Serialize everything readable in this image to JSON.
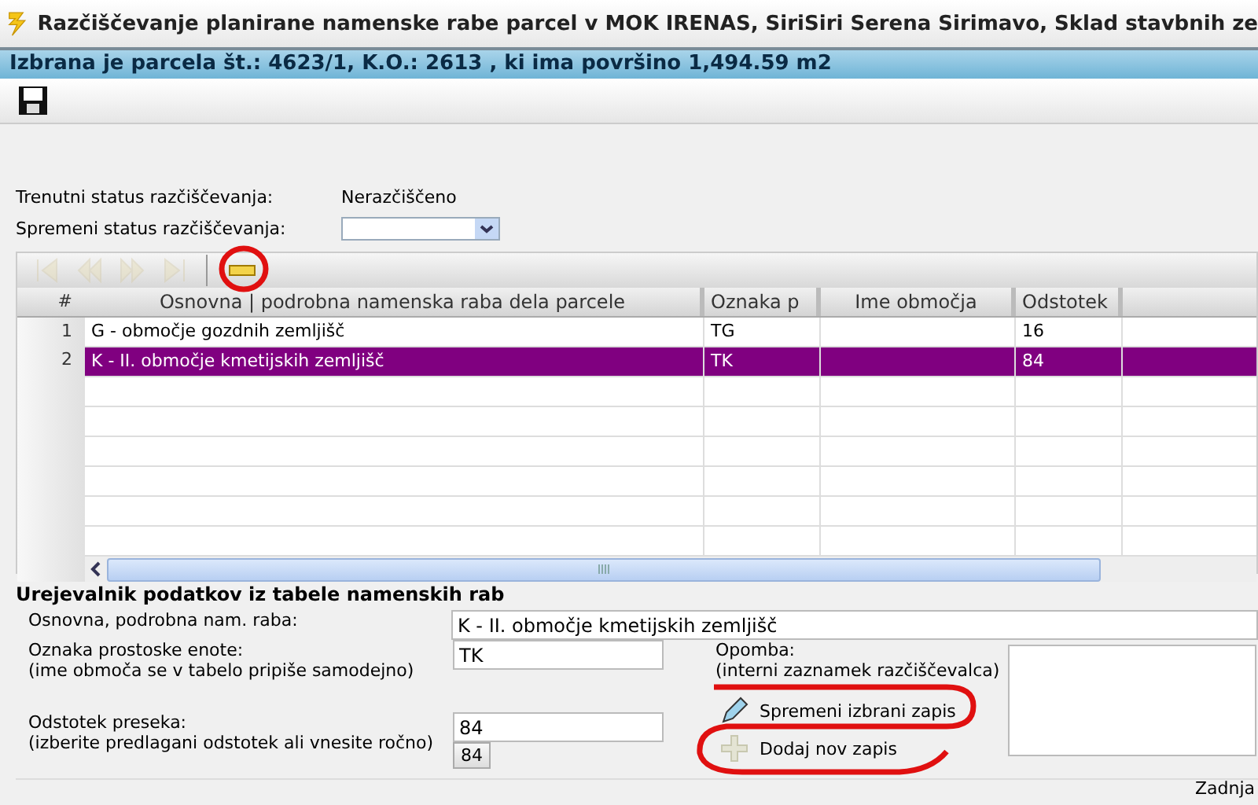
{
  "window": {
    "title": "Razčiščevanje planirane namenske rabe parcel v MOK  IRENAS, SiriSiri Serena Sirimavo, Sklad stavbnih ze"
  },
  "info_bar": {
    "text": "Izbrana je parcela št.: 4623/1, K.O.: 2613 , ki ima površino 1,494.59 m2"
  },
  "status": {
    "current_label": "Trenutni status razčiščevanja:",
    "current_value": "Nerazčiščeno",
    "change_label": "Spremeni status razčiščevanja:"
  },
  "grid": {
    "nav_buttons": [
      {
        "kind": "first",
        "disabled": true
      },
      {
        "kind": "prev",
        "disabled": true
      },
      {
        "kind": "next",
        "disabled": true
      },
      {
        "kind": "last",
        "disabled": true
      },
      {
        "kind": "delete",
        "disabled": false
      }
    ],
    "columns": [
      "#",
      "Osnovna | podrobna namenska raba dela parcele",
      "Oznaka p",
      "Ime območja",
      "Odstotek"
    ],
    "rows": [
      {
        "cells": [
          "1",
          "G - območje gozdnih zemljišč",
          "TG",
          "",
          "16"
        ],
        "selected": false
      },
      {
        "cells": [
          "2",
          "K - II. območje kmetijskih zemljišč",
          "TK",
          "",
          "84"
        ],
        "selected": true
      }
    ]
  },
  "editor": {
    "title": "Urejevalnik podatkov iz tabele namenskih rab",
    "fields": [
      {
        "kind": "wide",
        "label": "Osnovna, podrobna nam. raba:",
        "value": "K - II. območje kmetijskih zemljišč"
      },
      {
        "kind": "short",
        "label": "Oznaka prostoske enote:",
        "hint": "(ime območa se v tabelo pripiše samodejno)",
        "value": "TK"
      },
      {
        "kind": "suggest",
        "label": "Odstotek preseka:",
        "hint": "(izberite predlagani odstotek ali vnesite ročno)",
        "value": "84",
        "suggestion": "84"
      }
    ],
    "note": {
      "label": "Opomba:",
      "hint": "(interni zaznamek razčiščevalca)"
    },
    "buttons": [
      {
        "kind": "edit",
        "label": "Spremeni izbrani zapis"
      },
      {
        "kind": "add",
        "label": "Dodaj nov zapis"
      }
    ]
  },
  "footer": {
    "text": "Zadnja"
  }
}
